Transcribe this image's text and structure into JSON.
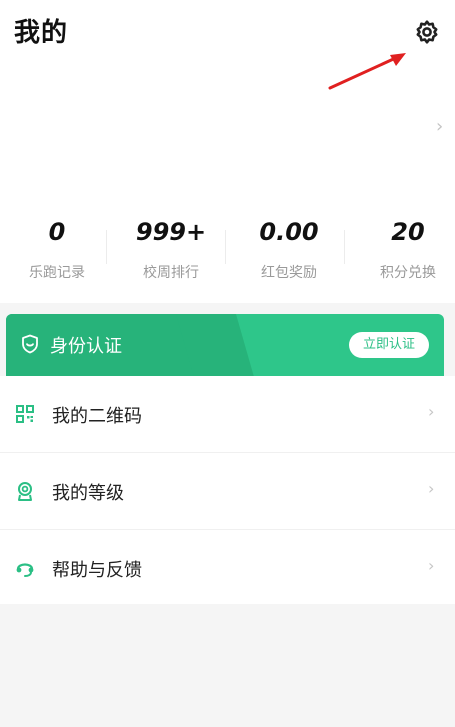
{
  "header": {
    "title": "我的",
    "settings_icon": "gear-icon"
  },
  "annotation": {
    "arrow_color": "#e02020"
  },
  "profile": {
    "chevron": "›"
  },
  "stats": [
    {
      "value": "0",
      "label": "乐跑记录"
    },
    {
      "value": "999+",
      "label": "校周排行"
    },
    {
      "value": "0.00",
      "label": "红包奖励"
    },
    {
      "value": "20",
      "label": "积分兑换"
    }
  ],
  "banner": {
    "title": "身份认证",
    "button_label": "立即认证",
    "icon": "shield-icon",
    "accent_color": "#2ec68a"
  },
  "menu": [
    {
      "label": "我的二维码",
      "icon": "qr-code-icon",
      "chevron": "›"
    },
    {
      "label": "我的等级",
      "icon": "medal-icon",
      "chevron": "›"
    },
    {
      "label": "帮助与反馈",
      "icon": "headset-icon",
      "chevron": "›"
    }
  ]
}
